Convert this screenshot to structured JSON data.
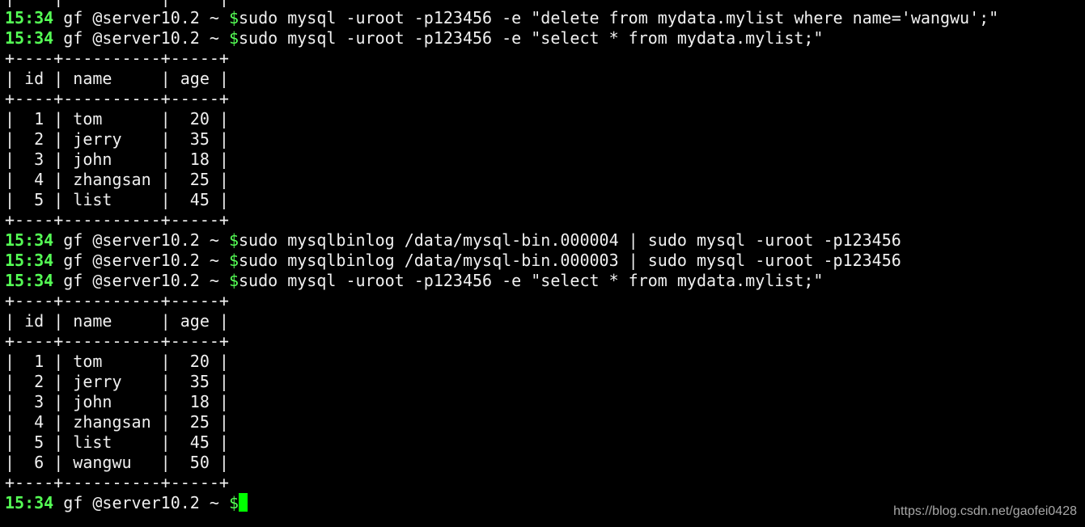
{
  "terminal": {
    "prompt": {
      "time": "15:34",
      "userhost": " gf @server10.2 ~ ",
      "symbol": "$"
    },
    "lines": [
      {
        "type": "out",
        "text": "|    |          |     |"
      },
      {
        "type": "prompt",
        "cmd": "sudo mysql -uroot -p123456 -e \"delete from mydata.mylist where name='wangwu';\""
      },
      {
        "type": "prompt",
        "cmd": "sudo mysql -uroot -p123456 -e \"select * from mydata.mylist;\""
      },
      {
        "type": "out",
        "text": "+----+----------+-----+"
      },
      {
        "type": "out",
        "text": "| id | name     | age |"
      },
      {
        "type": "out",
        "text": "+----+----------+-----+"
      },
      {
        "type": "out",
        "text": "|  1 | tom      |  20 |"
      },
      {
        "type": "out",
        "text": "|  2 | jerry    |  35 |"
      },
      {
        "type": "out",
        "text": "|  3 | john     |  18 |"
      },
      {
        "type": "out",
        "text": "|  4 | zhangsan |  25 |"
      },
      {
        "type": "out",
        "text": "|  5 | list     |  45 |"
      },
      {
        "type": "out",
        "text": "+----+----------+-----+"
      },
      {
        "type": "prompt",
        "cmd": "sudo mysqlbinlog /data/mysql-bin.000004 | sudo mysql -uroot -p123456"
      },
      {
        "type": "prompt",
        "cmd": "sudo mysqlbinlog /data/mysql-bin.000003 | sudo mysql -uroot -p123456"
      },
      {
        "type": "prompt",
        "cmd": "sudo mysql -uroot -p123456 -e \"select * from mydata.mylist;\""
      },
      {
        "type": "out",
        "text": "+----+----------+-----+"
      },
      {
        "type": "out",
        "text": "| id | name     | age |"
      },
      {
        "type": "out",
        "text": "+----+----------+-----+"
      },
      {
        "type": "out",
        "text": "|  1 | tom      |  20 |"
      },
      {
        "type": "out",
        "text": "|  2 | jerry    |  35 |"
      },
      {
        "type": "out",
        "text": "|  3 | john     |  18 |"
      },
      {
        "type": "out",
        "text": "|  4 | zhangsan |  25 |"
      },
      {
        "type": "out",
        "text": "|  5 | list     |  45 |"
      },
      {
        "type": "out",
        "text": "|  6 | wangwu   |  50 |"
      },
      {
        "type": "out",
        "text": "+----+----------+-----+"
      },
      {
        "type": "prompt",
        "cmd": "",
        "cursor": true
      }
    ]
  },
  "watermark": "https://blog.csdn.net/gaofei0428",
  "colors": {
    "prompt_green": "#55ff55",
    "text": "#f0f0f0",
    "background": "#000000",
    "cursor": "#00ff00"
  }
}
